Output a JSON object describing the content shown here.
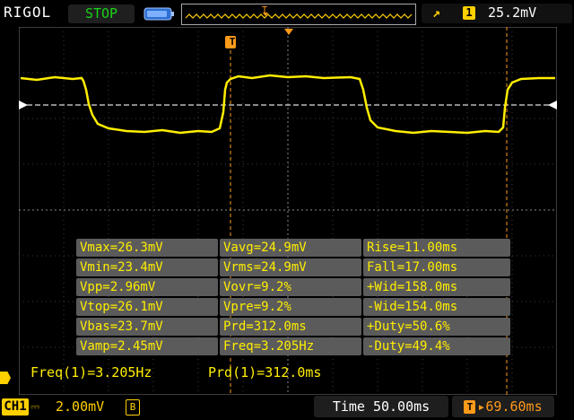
{
  "header": {
    "brand": "RIGOL",
    "run_state": "STOP",
    "trigger_edge_symbol": "↗",
    "trigger_source": "1",
    "trigger_level": "25.2mV"
  },
  "markers": {
    "trigger_position": "T",
    "trigger_point": "T"
  },
  "measurements": [
    [
      "Vmax=26.3mV",
      "Vavg=24.9mV",
      "Rise=11.00ms"
    ],
    [
      "Vmin=23.4mV",
      "Vrms=24.9mV",
      "Fall=17.00ms"
    ],
    [
      "Vpp=2.96mV",
      "Vovr=9.2%",
      "+Wid=158.0ms"
    ],
    [
      "Vtop=26.1mV",
      "Vpre=9.2%",
      "-Wid=154.0ms"
    ],
    [
      "Vbas=23.7mV",
      "Prd=312.0ms",
      "+Duty=50.6%"
    ],
    [
      "Vamp=2.45mV",
      "Freq=3.205Hz",
      "-Duty=49.4%"
    ]
  ],
  "counters": {
    "freq": "Freq(1)=3.205Hz",
    "period": "Prd(1)=312.0ms"
  },
  "footer": {
    "channel": "CH1",
    "coupling_symbol": "⎓",
    "vertical_scale": "2.00mV",
    "bandwidth_limit": "B",
    "timebase": "Time 50.00ms",
    "trigger_offset_symbol": "T",
    "trigger_offset": "69.60ms"
  },
  "colors": {
    "trace": "#ffee00",
    "channel": "#ffd000",
    "stop": "#19d219",
    "trigger_marker": "#ff9a1a"
  }
}
